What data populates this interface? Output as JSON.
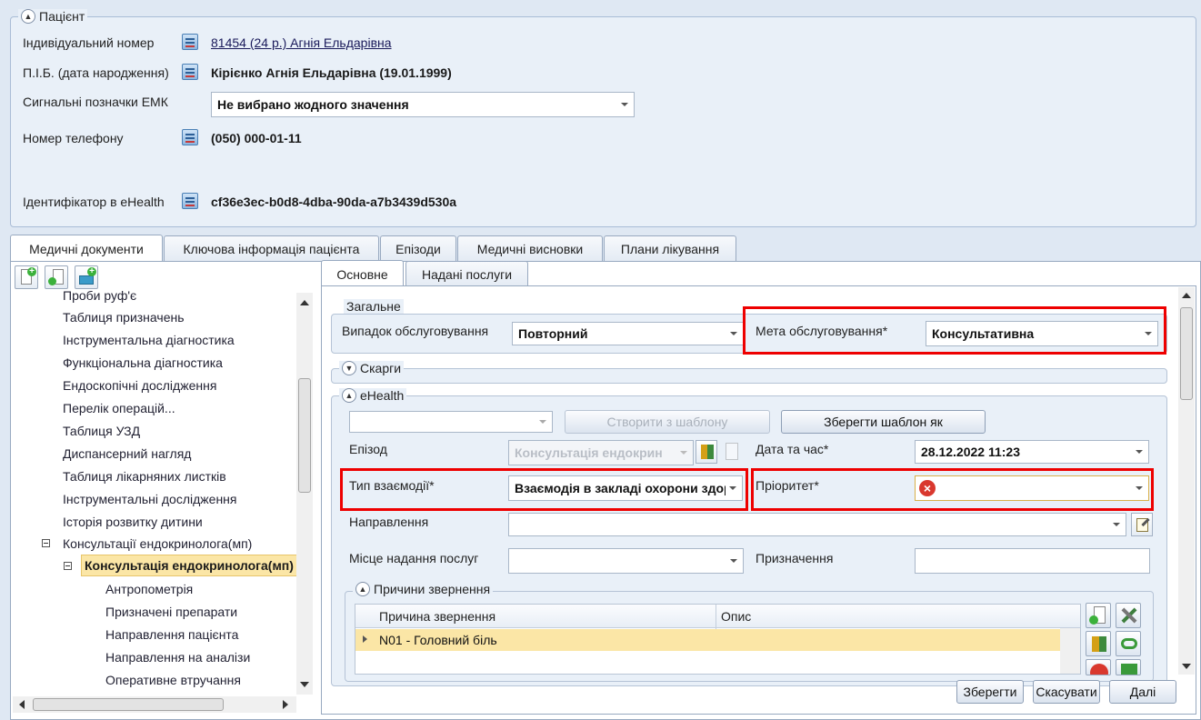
{
  "patient": {
    "legend": "Пацієнт",
    "id_label": "Індивідуальний номер",
    "id_value": "81454 (24 р.) Агнія Ельдарівна",
    "name_label": "П.І.Б. (дата народження)",
    "name_value": "Кірієнко Агнія Ельдарівна (19.01.1999)",
    "signals_label": "Сигнальні позначки ЕМК",
    "signals_value": "Не вибрано жодного значення",
    "phone_label": "Номер телефону",
    "phone_value": "(050) 000-01-11",
    "ehealth_label": "Ідентифікатор в eHealth",
    "ehealth_value": "cf36e3ec-b0d8-4dba-90da-a7b3439d530a"
  },
  "main_tabs": [
    "Медичні документи",
    "Ключова інформація пацієнта",
    "Епізоди",
    "Медичні висновки",
    "Плани лікування"
  ],
  "tree": {
    "items": [
      "Проби руф'є",
      "Таблиця призначень",
      "Інструментальна діагностика",
      "Функціональна діагностика",
      "Ендоскопічні дослідження",
      "Перелік операцій...",
      "Таблиця УЗД",
      "Диспансерний нагляд",
      "Таблиця лікарняних листків",
      "Інструментальні дослідження",
      "Історія розвитку дитини",
      "Консультації ендокринолога(мп)",
      "Консультація ендокринолога(мп)",
      "Антропометрія",
      "Призначені препарати",
      "Направлення пацієнта",
      "Направлення на аналізи",
      "Оперативне втручання"
    ]
  },
  "sub_tabs": [
    "Основне",
    "Надані послуги"
  ],
  "general": {
    "legend": "Загальне",
    "case_label": "Випадок обслуговування",
    "case_value": "Повторний",
    "goal_label": "Мета обслуговування*",
    "goal_value": "Консультативна"
  },
  "complaints": {
    "legend": "Скарги"
  },
  "ehealth": {
    "legend": "eHealth",
    "template_value": "",
    "create_from_template": "Створити з шаблону",
    "save_template_as": "Зберегти шаблон як",
    "episode_label": "Епізод",
    "episode_value": "Консультація ендокрин",
    "datetime_label": "Дата та час*",
    "datetime_value": "28.12.2022 11:23",
    "interaction_label": "Тип взаємодії*",
    "interaction_value": "Взаємодія в закладі охорони здоров'я",
    "priority_label": "Пріоритет*",
    "priority_value": "",
    "referral_label": "Направлення",
    "referral_value": "",
    "place_label": "Місце надання послуг",
    "place_value": "",
    "purpose_label": "Призначення",
    "purpose_value": ""
  },
  "reasons": {
    "legend": "Причини звернення",
    "columns": [
      "Причина звернення",
      "Опис"
    ],
    "rows": [
      {
        "reason": "N01 - Головний біль",
        "desc": ""
      }
    ]
  },
  "footer": {
    "save": "Зберегти",
    "cancel": "Скасувати",
    "next": "Далі"
  },
  "colors": {
    "highlight": "#fbe6a6",
    "selection_box": "#ee0000",
    "error": "#d9382e"
  }
}
